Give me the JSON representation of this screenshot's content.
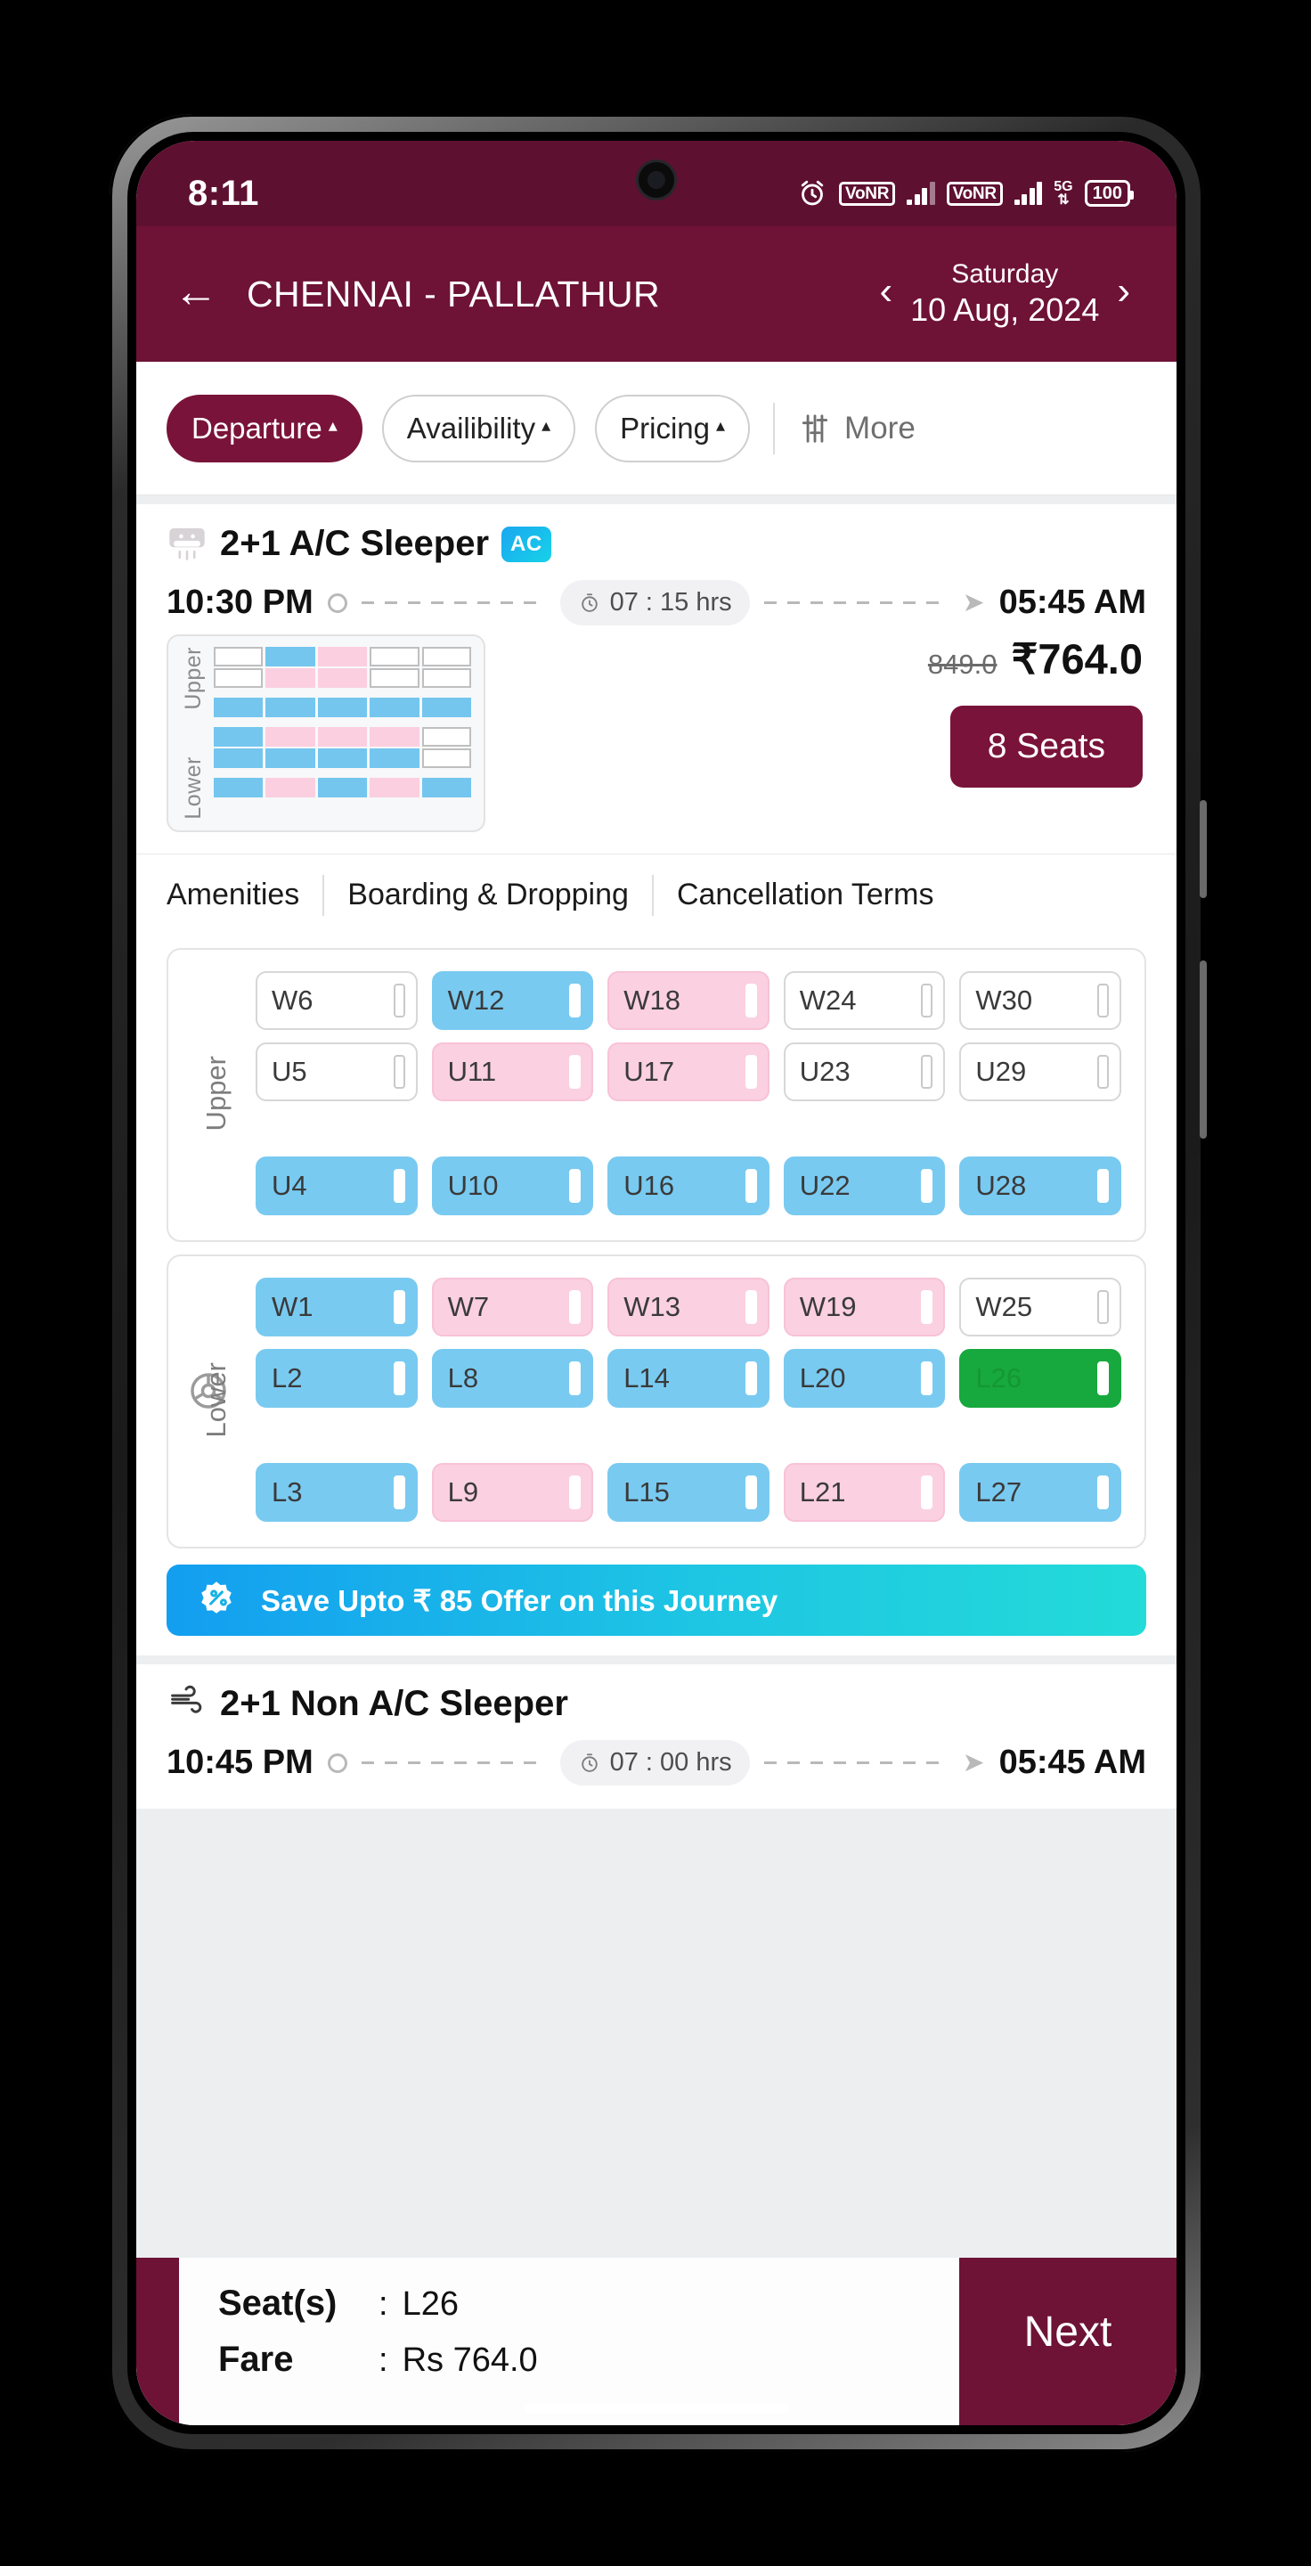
{
  "status_bar": {
    "time": "8:11",
    "icons": [
      "alarm-clock-icon",
      "vonr-badge",
      "signal-bars",
      "vonr-badge",
      "signal-bars",
      "5g-icon",
      "battery-icon"
    ],
    "vonr_label": "VoNR",
    "network_label": "5G",
    "battery_level": "100"
  },
  "header": {
    "back_icon": "back-arrow-icon",
    "route": "CHENNAI - PALLATHUR",
    "prev_icon": "chevron-left-icon",
    "next_icon": "chevron-right-icon",
    "day": "Saturday",
    "date": "10 Aug, 2024"
  },
  "filters": {
    "chips": [
      {
        "label": "Departure",
        "caret": "▴",
        "active": true
      },
      {
        "label": "Availibility",
        "caret": "▴",
        "active": false
      },
      {
        "label": "Pricing",
        "caret": "▴",
        "active": false
      }
    ],
    "more_label": "More",
    "more_icon": "filter-sliders-icon"
  },
  "bus_card": {
    "icon": "ac-bus-icon",
    "name": "2+1 A/C Sleeper",
    "ac_badge": "AC",
    "departure_time": "10:30 PM",
    "duration": "07 : 15 hrs",
    "duration_icon": "clock-icon",
    "arrival_time": "05:45 AM",
    "price_old": "849.0",
    "price_new": "₹764.0",
    "seats_button": "8 Seats",
    "thumbnail": {
      "upper_label": "Upper",
      "lower_label": "Lower",
      "upper_block": [
        [
          "white",
          "blue",
          "pink",
          "white",
          "white"
        ],
        [
          "white",
          "pink",
          "pink",
          "white",
          "white"
        ]
      ],
      "upper_single": [
        "blue",
        "blue",
        "blue",
        "blue",
        "blue"
      ],
      "lower_block": [
        [
          "blue",
          "pink",
          "pink",
          "pink",
          "white"
        ],
        [
          "blue",
          "blue",
          "blue",
          "blue",
          "white"
        ]
      ],
      "lower_single": [
        "blue",
        "pink",
        "blue",
        "pink",
        "blue"
      ]
    },
    "tabs": [
      "Amenities",
      "Boarding & Dropping",
      "Cancellation Terms"
    ]
  },
  "seat_map": {
    "upper": {
      "label": "Upper",
      "rows": [
        [
          {
            "label": "W6",
            "state": "available"
          },
          {
            "label": "W12",
            "state": "male"
          },
          {
            "label": "W18",
            "state": "female"
          },
          {
            "label": "W24",
            "state": "available"
          },
          {
            "label": "W30",
            "state": "available"
          }
        ],
        [
          {
            "label": "U5",
            "state": "available"
          },
          {
            "label": "U11",
            "state": "female"
          },
          {
            "label": "U17",
            "state": "female"
          },
          {
            "label": "U23",
            "state": "available"
          },
          {
            "label": "U29",
            "state": "available"
          }
        ],
        [
          {
            "label": "U4",
            "state": "male"
          },
          {
            "label": "U10",
            "state": "male"
          },
          {
            "label": "U16",
            "state": "male"
          },
          {
            "label": "U22",
            "state": "male"
          },
          {
            "label": "U28",
            "state": "male"
          }
        ]
      ]
    },
    "lower": {
      "label": "Lower",
      "wheel_icon": "steering-wheel-icon",
      "rows": [
        [
          {
            "label": "W1",
            "state": "male"
          },
          {
            "label": "W7",
            "state": "female"
          },
          {
            "label": "W13",
            "state": "female"
          },
          {
            "label": "W19",
            "state": "female"
          },
          {
            "label": "W25",
            "state": "available"
          }
        ],
        [
          {
            "label": "L2",
            "state": "male"
          },
          {
            "label": "L8",
            "state": "male"
          },
          {
            "label": "L14",
            "state": "male"
          },
          {
            "label": "L20",
            "state": "male"
          },
          {
            "label": "L26",
            "state": "selected"
          }
        ],
        [
          {
            "label": "L3",
            "state": "male"
          },
          {
            "label": "L9",
            "state": "female"
          },
          {
            "label": "L15",
            "state": "male"
          },
          {
            "label": "L21",
            "state": "female"
          },
          {
            "label": "L27",
            "state": "male"
          }
        ]
      ]
    }
  },
  "offer": {
    "icon": "discount-badge-icon",
    "text": "Save Upto ₹ 85 Offer on this Journey"
  },
  "bus_card_2": {
    "icon": "non-ac-bus-icon",
    "name": "2+1 Non A/C Sleeper",
    "departure_time": "10:45 PM",
    "duration": "07 : 00 hrs",
    "arrival_time": "05:45 AM"
  },
  "bottom_bar": {
    "seats_key": "Seat(s)",
    "seats_sep": ":",
    "seats_value": "L26",
    "fare_key": "Fare",
    "fare_sep": ":",
    "fare_value": "Rs 764.0",
    "next_label": "Next"
  },
  "colors": {
    "brand": "#6e1236",
    "chip_active": "#7a1339",
    "seat_male": "#79caf0",
    "seat_female": "#fbd0e1",
    "seat_selected": "#17a93e",
    "offer_start": "#139ef0",
    "offer_end": "#23dbd9"
  }
}
